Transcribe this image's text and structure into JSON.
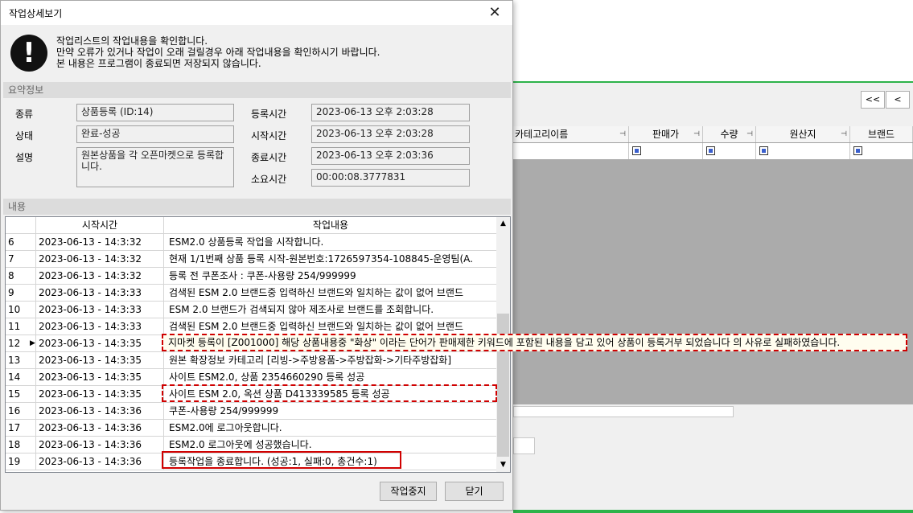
{
  "background_app": {
    "nav_buttons": [
      "<<",
      "<"
    ],
    "grid_columns": [
      "카테고리이름",
      "판매가",
      "수량",
      "원산지",
      "브랜드"
    ],
    "colors": {
      "accent_green": "#2db34a"
    }
  },
  "dialog": {
    "title": "작업상세보기",
    "close_glyph": "✕",
    "icon": "exclamation-icon",
    "messages": [
      "작업리스트의 작업내용을 확인합니다.",
      "만약 오류가 있거나 작업이 오래 걸릴경우 아래 작업내용을 확인하시기 바랍니다.",
      "본 내용은 프로그램이 종료되면 저장되지 않습니다."
    ],
    "summary": {
      "section_title": "요약정보",
      "type_label": "종류",
      "type_value": "상품등록 (ID:14)",
      "status_label": "상태",
      "status_value": "완료-성공",
      "desc_label": "설명",
      "desc_value": "원본상품을 각 오픈마켓으로 등록합니다.",
      "reg_time_label": "등록시간",
      "reg_time_value": "2023-06-13 오후 2:03:28",
      "start_time_label": "시작시간",
      "start_time_value": "2023-06-13 오후 2:03:28",
      "end_time_label": "종료시간",
      "end_time_value": "2023-06-13 오후 2:03:36",
      "elapsed_label": "소요시간",
      "elapsed_value": "00:00:08.3777831"
    },
    "content": {
      "section_title": "내용",
      "columns": [
        "시작시간",
        "작업내용"
      ],
      "rows": [
        {
          "num": "6",
          "time": "2023-06-13 - 14:3:32",
          "msg": "ESM2.0 상품등록 작업을 시작합니다."
        },
        {
          "num": "7",
          "time": "2023-06-13 - 14:3:32",
          "msg": "현재 1/1번째 상품 등록 시작-원본번호:1726597354-108845-운영팀(A."
        },
        {
          "num": "8",
          "time": "2023-06-13 - 14:3:32",
          "msg": "등록 전 쿠폰조사 : 쿠폰-사용량 254/999999"
        },
        {
          "num": "9",
          "time": "2023-06-13 - 14:3:33",
          "msg": "검색된 ESM 2.0 브랜드중 입력하신 브랜드와 일치하는 값이 없어 브랜드"
        },
        {
          "num": "10",
          "time": "2023-06-13 - 14:3:33",
          "msg": "ESM 2.0 브랜드가 검색되지 않아 제조사로 브랜드를 조회합니다."
        },
        {
          "num": "11",
          "time": "2023-06-13 - 14:3:33",
          "msg": "검색된 ESM 2.0 브랜드중 입력하신 브랜드와 일치하는 값이 없어 브랜드"
        },
        {
          "num": "12",
          "time": "2023-06-13 - 14:3:35",
          "msg": "지마켓 등록이 [Z001000] 해당 상품내용중 \"화상\" 이라는 단어가 판매제한 키워드에 포함된 내용을 담고 있어 상품이 등록거부 되었습니다 의 사유로 실패하였습니다."
        },
        {
          "num": "13",
          "time": "2023-06-13 - 14:3:35",
          "msg": "원본 확장정보 카테고리 [리빙->주방용품->주방잡화->기타주방잡화]"
        },
        {
          "num": "14",
          "time": "2023-06-13 - 14:3:35",
          "msg": "사이트 ESM2.0, 상품 2354660290 등록 성공"
        },
        {
          "num": "15",
          "time": "2023-06-13 - 14:3:35",
          "msg": "사이트 ESM 2.0, 옥션 상품 D413339585 등록 성공"
        },
        {
          "num": "16",
          "time": "2023-06-13 - 14:3:36",
          "msg": "쿠폰-사용량 254/999999"
        },
        {
          "num": "17",
          "time": "2023-06-13 - 14:3:36",
          "msg": "ESM2.0에 로그아웃합니다."
        },
        {
          "num": "18",
          "time": "2023-06-13 - 14:3:36",
          "msg": "ESM2.0 로그아웃에 성공했습니다."
        },
        {
          "num": "19",
          "time": "2023-06-13 - 14:3:36",
          "msg": "등록작업을 종료합니다. (성공:1, 실패:0, 총건수:1)"
        }
      ],
      "selected_row": "12"
    },
    "buttons": {
      "stop": "작업중지",
      "close": "닫기"
    }
  }
}
